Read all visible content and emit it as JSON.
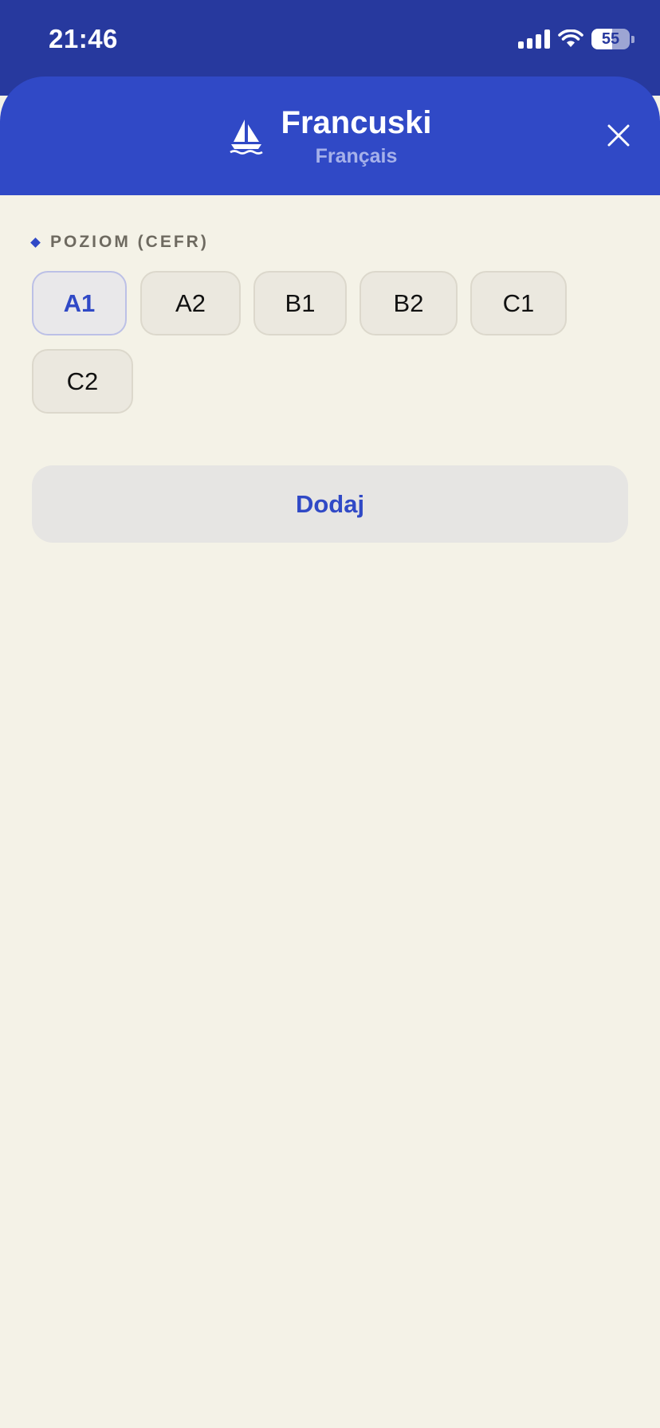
{
  "status_bar": {
    "time": "21:46",
    "battery_level": "55",
    "battery_percent": 55,
    "icons": [
      "signal-icon",
      "wifi-icon",
      "battery-icon"
    ]
  },
  "header": {
    "title": "Francuski",
    "subtitle": "Français",
    "icon": "sailboat-icon",
    "close_icon": "close-icon"
  },
  "level_section": {
    "label": "POZIOM (CEFR)",
    "options": [
      "A1",
      "A2",
      "B1",
      "B2",
      "C1",
      "C2"
    ],
    "selected": "A1"
  },
  "add_button": {
    "label": "Dodaj"
  },
  "colors": {
    "status_bar_bg": "#27399e",
    "header_bg": "#3049c6",
    "accent": "#3049c6",
    "background": "#f4f2e7",
    "chip_bg": "#ebe8df",
    "button_bg": "#e6e5e3"
  }
}
